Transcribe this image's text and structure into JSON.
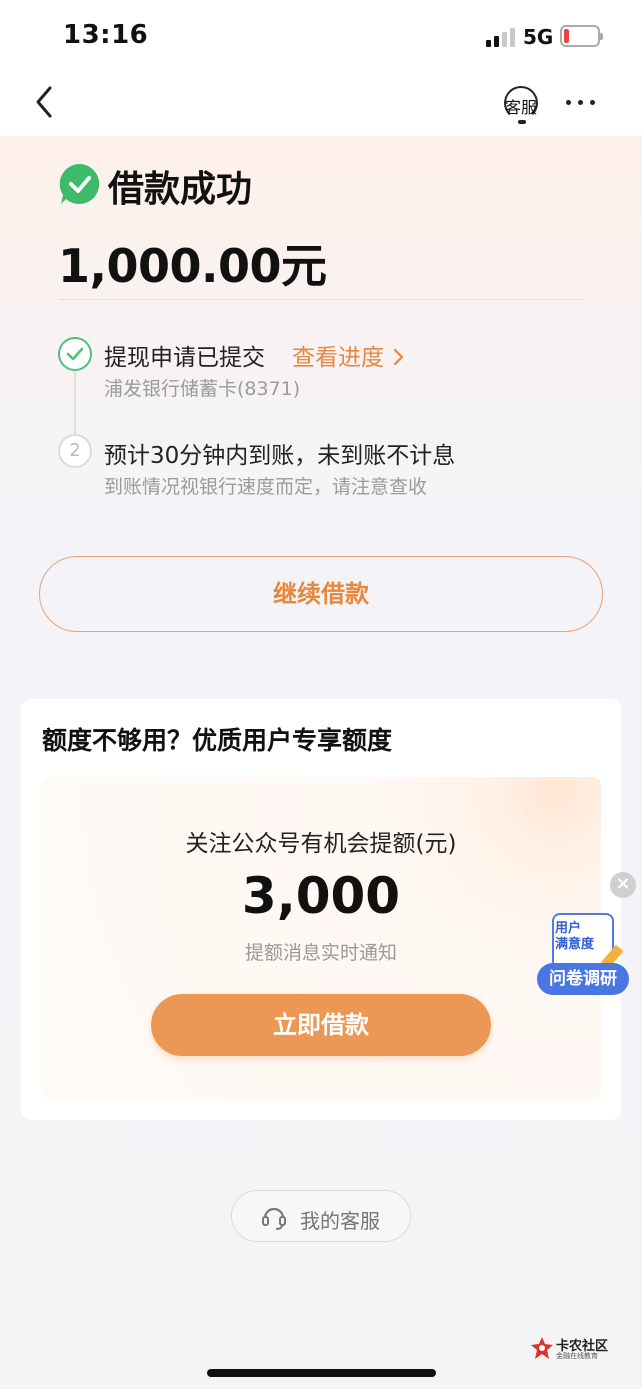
{
  "status_bar": {
    "time": "13:16",
    "network": "5G",
    "battery_level": 0.15,
    "battery_color": "#e8453c"
  },
  "nav": {
    "back_icon": "chevron-left-icon",
    "service_label": "客服",
    "more_icon": "more-dots-icon"
  },
  "result": {
    "title": "借款成功",
    "amount": "1,000.00元",
    "success_color": "#3dbb6a"
  },
  "steps": [
    {
      "title": "提现申请已提交",
      "link": "查看进度",
      "sub": "浦发银行储蓄卡(8371)",
      "state": "done"
    },
    {
      "number": "2",
      "title": "预计30分钟内到账，未到账不计息",
      "sub": "到账情况视银行速度而定，请注意查收",
      "state": "pending"
    }
  ],
  "continue_button": "继续借款",
  "promo": {
    "title": "额度不够用？优质用户专享额度",
    "label": "关注公众号有机会提额(元)",
    "amount": "3,000",
    "sub": "提额消息实时通知",
    "button": "立即借款",
    "accent": "#ec9754"
  },
  "survey": {
    "paper_text": "用户\n满意度",
    "band": "问卷调研",
    "color": "#4a76e4"
  },
  "my_service": {
    "label": "我的客服"
  },
  "watermark": {
    "name": "卡农社区",
    "tagline": "金融在线教育"
  }
}
